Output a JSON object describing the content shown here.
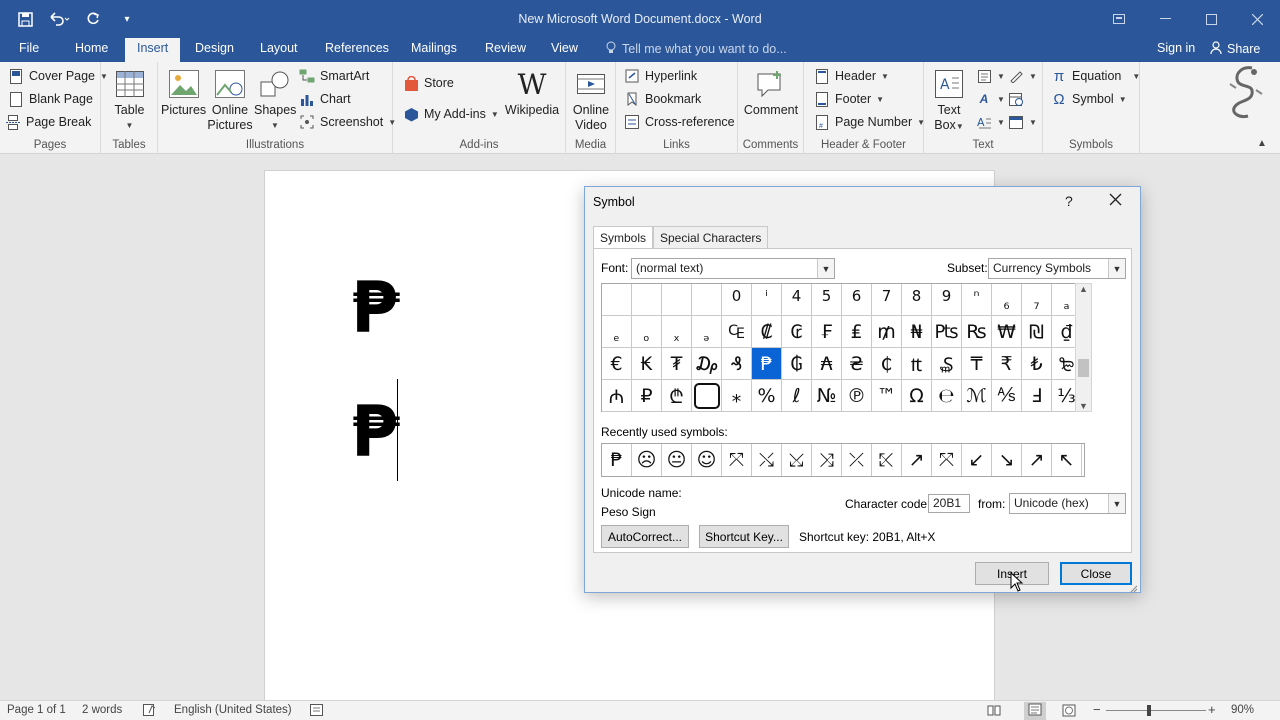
{
  "window": {
    "title": "New Microsoft Word Document.docx - Word"
  },
  "tabs": {
    "file": "File",
    "home": "Home",
    "insert": "Insert",
    "design": "Design",
    "layout": "Layout",
    "references": "References",
    "mailings": "Mailings",
    "review": "Review",
    "view": "View",
    "tell_me": "Tell me what you want to do...",
    "sign_in": "Sign in",
    "share": "Share"
  },
  "ribbon": {
    "pages": {
      "name": "Pages",
      "cover_page": "Cover Page",
      "blank_page": "Blank Page",
      "page_break": "Page Break"
    },
    "tables": {
      "name": "Tables",
      "table": "Table"
    },
    "illustrations": {
      "name": "Illustrations",
      "pictures": "Pictures",
      "online_pictures_1": "Online",
      "online_pictures_2": "Pictures",
      "shapes": "Shapes",
      "smartart": "SmartArt",
      "chart": "Chart",
      "screenshot": "Screenshot"
    },
    "addins": {
      "name": "Add-ins",
      "store": "Store",
      "my_addins": "My Add-ins",
      "wikipedia": "Wikipedia"
    },
    "media": {
      "name": "Media",
      "online_video_1": "Online",
      "online_video_2": "Video"
    },
    "links": {
      "name": "Links",
      "hyperlink": "Hyperlink",
      "bookmark": "Bookmark",
      "cross_reference": "Cross-reference"
    },
    "comments": {
      "name": "Comments",
      "comment": "Comment"
    },
    "header_footer": {
      "name": "Header & Footer",
      "header": "Header",
      "footer": "Footer",
      "page_number": "Page Number"
    },
    "text": {
      "name": "Text",
      "text_box_1": "Text",
      "text_box_2": "Box"
    },
    "symbols": {
      "name": "Symbols",
      "equation": "Equation",
      "symbol": "Symbol"
    }
  },
  "document": {
    "symbol_1": "₱",
    "symbol_2": "₱"
  },
  "status": {
    "page": "Page 1 of 1",
    "words": "2 words",
    "language": "English (United States)",
    "zoom": "90%"
  },
  "dialog": {
    "title": "Symbol",
    "help": "?",
    "tab_symbols": "Symbols",
    "tab_special": "Special Characters",
    "font_label": "Font:",
    "font_value": "(normal text)",
    "subset_label": "Subset:",
    "subset_value": "Currency Symbols",
    "recent_label": "Recently used symbols:",
    "unicode_name_label": "Unicode name:",
    "unicode_name_value": "Peso Sign",
    "char_code_label": "Character code:",
    "char_code_value": "20B1",
    "from_label": "from:",
    "from_value": "Unicode (hex)",
    "autocorrect": "AutoCorrect...",
    "shortcut_key_btn": "Shortcut Key...",
    "shortcut_text": "Shortcut key: 20B1, Alt+X",
    "insert": "Insert",
    "close": "Close",
    "grid_rows": [
      [
        "",
        "",
        "",
        "",
        "0",
        "ⁱ",
        "4",
        "5",
        "6",
        "7",
        "8",
        "9",
        "ⁿ",
        "₆",
        "₇",
        "ₐ"
      ],
      [
        "ₑ",
        "ₒ",
        "ₓ",
        "ₔ",
        "₠",
        "₡",
        "₢",
        "₣",
        "₤",
        "₥",
        "₦",
        "₧",
        "₨",
        "₩",
        "₪",
        "₫"
      ],
      [
        "€",
        "₭",
        "₮",
        "₯",
        "₰",
        "₱",
        "₲",
        "₳",
        "₴",
        "₵",
        "₶",
        "₷",
        "₸",
        "₹",
        "₺",
        "₻"
      ],
      [
        "₼",
        "₽",
        "₾",
        "",
        "⁎",
        "%",
        "ℓ",
        "№",
        "℗",
        "™",
        "Ω",
        "℮",
        "ℳ",
        "⅍",
        "Ⅎ",
        "⅓"
      ]
    ],
    "selected_cell": "2-5",
    "recent": [
      "₱",
      "☹",
      "😐",
      "☺",
      "⤧",
      "⤯",
      "⤩",
      "⤨",
      "⤫",
      "⤪",
      "↗",
      "⤧",
      "↙",
      "↘",
      "↗",
      "↖"
    ]
  }
}
